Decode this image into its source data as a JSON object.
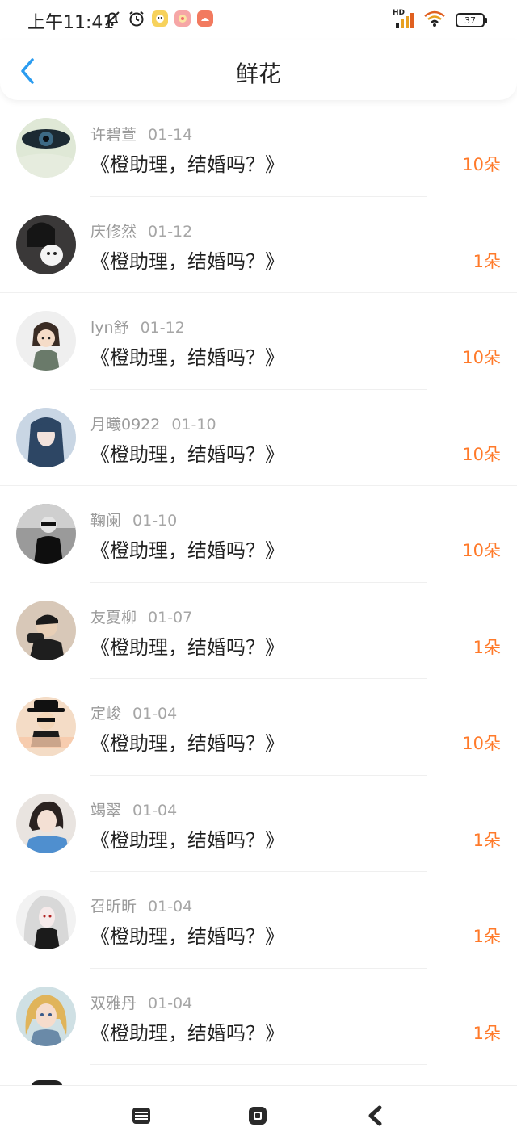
{
  "status_bar": {
    "time": "上午11:41",
    "battery": "37",
    "network_label": "HD",
    "icons": [
      "bell-off-icon",
      "alarm-icon",
      "app-notification-icon",
      "app-notification-icon",
      "app-notification-icon",
      "signal-icon",
      "wifi-icon",
      "battery-icon"
    ]
  },
  "header": {
    "title": "鲜花",
    "back_icon": "chevron-left-icon",
    "accent_color": "#2b9cf0"
  },
  "gift_count_color": "#ff7a2a",
  "records": [
    {
      "name": "许碧萱",
      "date": "01-14",
      "book": "《橙助理，结婚吗？》",
      "count": "10朵"
    },
    {
      "name": "庆修然",
      "date": "01-12",
      "book": "《橙助理，结婚吗？》",
      "count": "1朵"
    },
    {
      "name": "lyn舒",
      "date": "01-12",
      "book": "《橙助理，结婚吗？》",
      "count": "10朵"
    },
    {
      "name": "月曦0922",
      "date": "01-10",
      "book": "《橙助理，结婚吗？》",
      "count": "10朵"
    },
    {
      "name": "鞠阑",
      "date": "01-10",
      "book": "《橙助理，结婚吗？》",
      "count": "10朵"
    },
    {
      "name": "友夏柳",
      "date": "01-07",
      "book": "《橙助理，结婚吗？》",
      "count": "1朵"
    },
    {
      "name": "定峻",
      "date": "01-04",
      "book": "《橙助理，结婚吗？》",
      "count": "10朵"
    },
    {
      "name": "竭翠",
      "date": "01-04",
      "book": "《橙助理，结婚吗？》",
      "count": "1朵"
    },
    {
      "name": "召昕昕",
      "date": "01-04",
      "book": "《橙助理，结婚吗？》",
      "count": "1朵"
    },
    {
      "name": "双雅丹",
      "date": "01-04",
      "book": "《橙助理，结婚吗？》",
      "count": "1朵"
    }
  ],
  "system_nav": {
    "icons": [
      "menu-icon",
      "home-icon",
      "back-icon"
    ]
  }
}
